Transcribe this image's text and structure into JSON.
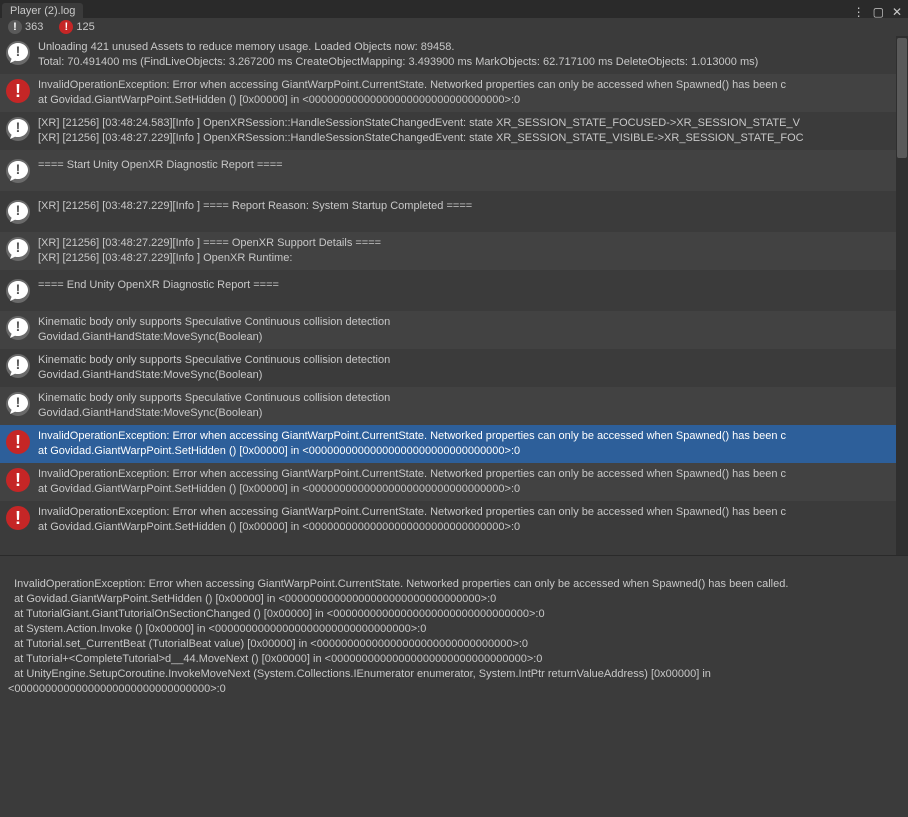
{
  "window": {
    "tab_title": "Player (2).log",
    "menu_glyph": "⋮",
    "maximize_glyph": "▢",
    "close_glyph": "✕"
  },
  "counts": {
    "info_label": "363",
    "error_label": "125"
  },
  "rows": [
    {
      "type": "info",
      "shade": "odd",
      "line1": "Unloading 421 unused Assets to reduce memory usage. Loaded Objects now: 89458.",
      "line2": "Total: 70.491400 ms (FindLiveObjects: 3.267200 ms CreateObjectMapping: 3.493900 ms MarkObjects: 62.717100 ms  DeleteObjects: 1.013000 ms)"
    },
    {
      "type": "error",
      "shade": "even",
      "line1": "InvalidOperationException: Error when accessing GiantWarpPoint.CurrentState. Networked properties can only be accessed when Spawned() has been c",
      "line2": "  at Govidad.GiantWarpPoint.SetHidden () [0x00000] in <00000000000000000000000000000000>:0"
    },
    {
      "type": "info",
      "shade": "odd",
      "line1": "[XR] [21256] [03:48:24.583][Info   ] OpenXRSession::HandleSessionStateChangedEvent: state XR_SESSION_STATE_FOCUSED->XR_SESSION_STATE_V",
      "line2": "[XR] [21256] [03:48:27.229][Info   ] OpenXRSession::HandleSessionStateChangedEvent: state XR_SESSION_STATE_VISIBLE->XR_SESSION_STATE_FOC"
    },
    {
      "type": "info",
      "shade": "even",
      "line1": "==== Start Unity OpenXR Diagnostic Report ====",
      "line2": ""
    },
    {
      "type": "info",
      "shade": "odd",
      "line1": "[XR] [21256] [03:48:27.229][Info   ] ==== Report Reason: System Startup Completed ====",
      "line2": ""
    },
    {
      "type": "info",
      "shade": "even",
      "line1": "[XR] [21256] [03:48:27.229][Info   ] ==== OpenXR Support Details ====",
      "line2": "[XR] [21256] [03:48:27.229][Info   ] OpenXR Runtime:"
    },
    {
      "type": "info",
      "shade": "odd",
      "line1": "==== End Unity OpenXR Diagnostic Report ====",
      "line2": ""
    },
    {
      "type": "info",
      "shade": "even",
      "line1": "Kinematic body only supports Speculative Continuous collision detection",
      "line2": "Govidad.GiantHandState:MoveSync(Boolean)"
    },
    {
      "type": "info",
      "shade": "odd",
      "line1": "Kinematic body only supports Speculative Continuous collision detection",
      "line2": "Govidad.GiantHandState:MoveSync(Boolean)"
    },
    {
      "type": "info",
      "shade": "even",
      "line1": "Kinematic body only supports Speculative Continuous collision detection",
      "line2": "Govidad.GiantHandState:MoveSync(Boolean)"
    },
    {
      "type": "error",
      "shade": "sel",
      "line1": "InvalidOperationException: Error when accessing GiantWarpPoint.CurrentState. Networked properties can only be accessed when Spawned() has been c",
      "line2": "  at Govidad.GiantWarpPoint.SetHidden () [0x00000] in <00000000000000000000000000000000>:0"
    },
    {
      "type": "error",
      "shade": "even",
      "line1": "InvalidOperationException: Error when accessing GiantWarpPoint.CurrentState. Networked properties can only be accessed when Spawned() has been c",
      "line2": "  at Govidad.GiantWarpPoint.SetHidden () [0x00000] in <00000000000000000000000000000000>:0"
    },
    {
      "type": "error",
      "shade": "odd",
      "line1": "InvalidOperationException: Error when accessing GiantWarpPoint.CurrentState. Networked properties can only be accessed when Spawned() has been c",
      "line2": "  at Govidad.GiantWarpPoint.SetHidden () [0x00000] in <00000000000000000000000000000000>:0"
    }
  ],
  "detail_text": "InvalidOperationException: Error when accessing GiantWarpPoint.CurrentState. Networked properties can only be accessed when Spawned() has been called.\n  at Govidad.GiantWarpPoint.SetHidden () [0x00000] in <00000000000000000000000000000000>:0\n  at TutorialGiant.GiantTutorialOnSectionChanged () [0x00000] in <00000000000000000000000000000000>:0\n  at System.Action.Invoke () [0x00000] in <00000000000000000000000000000000>:0\n  at Tutorial.set_CurrentBeat (TutorialBeat value) [0x00000] in <00000000000000000000000000000000>:0\n  at Tutorial+<CompleteTutorial>d__44.MoveNext () [0x00000] in <00000000000000000000000000000000>:0\n  at UnityEngine.SetupCoroutine.InvokeMoveNext (System.Collections.IEnumerator enumerator, System.IntPtr returnValueAddress) [0x00000] in <00000000000000000000000000000000>:0"
}
